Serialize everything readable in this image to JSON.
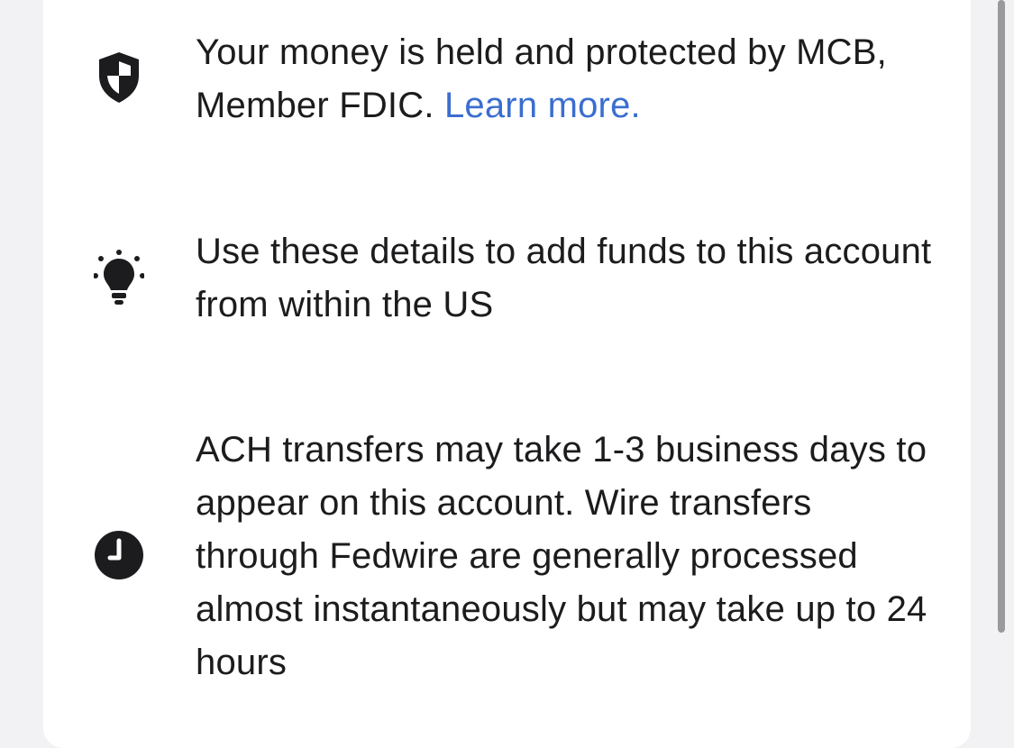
{
  "info_items": [
    {
      "icon": "shield-icon",
      "text": "Your money is held and protected by MCB, Member FDIC. ",
      "link_label": "Learn more."
    },
    {
      "icon": "lightbulb-icon",
      "text": "Use these details to add funds to this account from within the US"
    },
    {
      "icon": "clock-icon",
      "text": "ACH transfers may take 1-3 business days to appear on this account. Wire transfers through Fedwire are generally processed almost instantaneously but may take up to 24 hours"
    }
  ],
  "colors": {
    "background": "#f2f2f4",
    "card": "#ffffff",
    "text": "#1c1c1e",
    "link": "#3a6ed0",
    "icon": "#1c1c1e"
  }
}
